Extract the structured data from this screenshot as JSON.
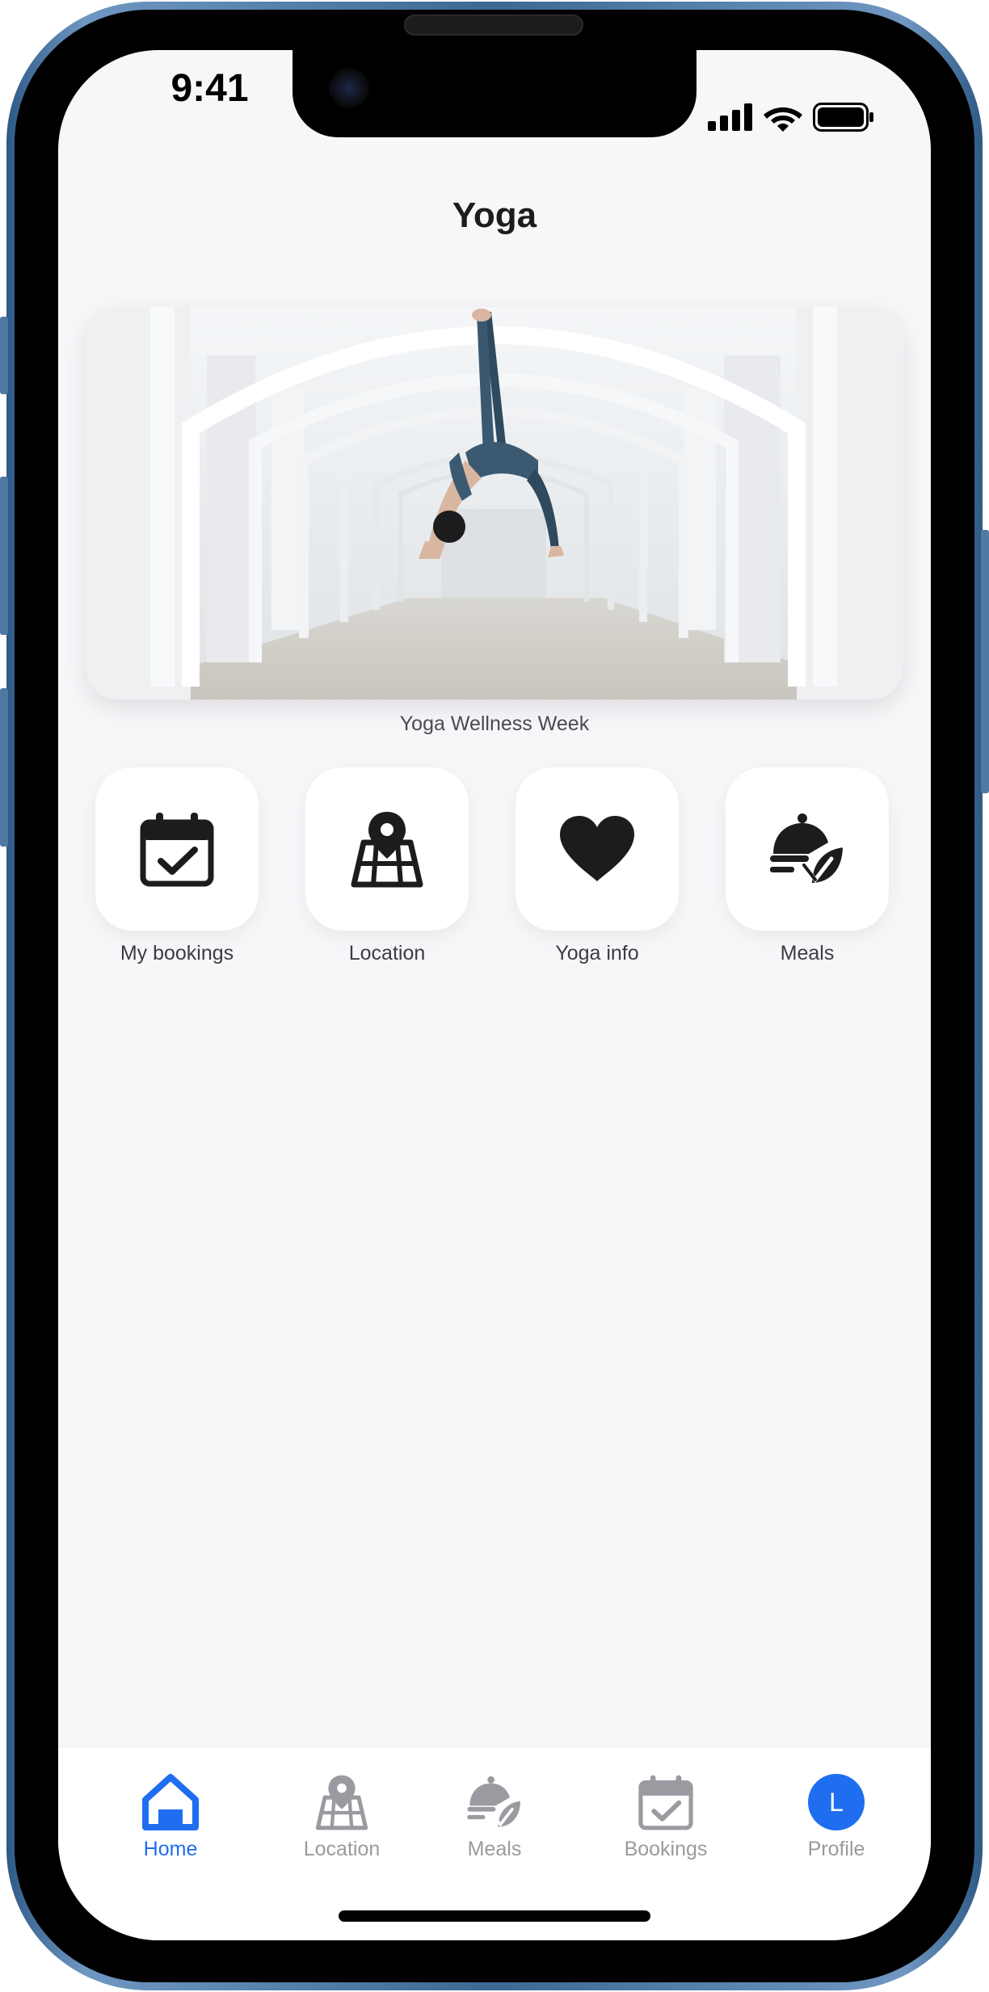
{
  "status_bar": {
    "time": "9:41"
  },
  "header": {
    "title": "Yoga"
  },
  "hero": {
    "caption": "Yoga Wellness Week"
  },
  "quick_actions": [
    {
      "label": "My bookings",
      "icon": "calendar-check-icon"
    },
    {
      "label": "Location",
      "icon": "map-pin-icon"
    },
    {
      "label": "Yoga info",
      "icon": "heart-icon"
    },
    {
      "label": "Meals",
      "icon": "meal-icon"
    }
  ],
  "tab_bar": {
    "items": [
      {
        "label": "Home",
        "icon": "home-icon",
        "active": true
      },
      {
        "label": "Location",
        "icon": "map-pin-icon",
        "active": false
      },
      {
        "label": "Meals",
        "icon": "meal-icon",
        "active": false
      },
      {
        "label": "Bookings",
        "icon": "calendar-check-icon",
        "active": false
      },
      {
        "label": "Profile",
        "icon": "avatar",
        "active": false,
        "avatar_initial": "L"
      }
    ]
  },
  "colors": {
    "accent": "#1f6ef0",
    "inactive": "#9a9aa0",
    "background": "#f7f6f9",
    "frame": "#3d6894"
  }
}
